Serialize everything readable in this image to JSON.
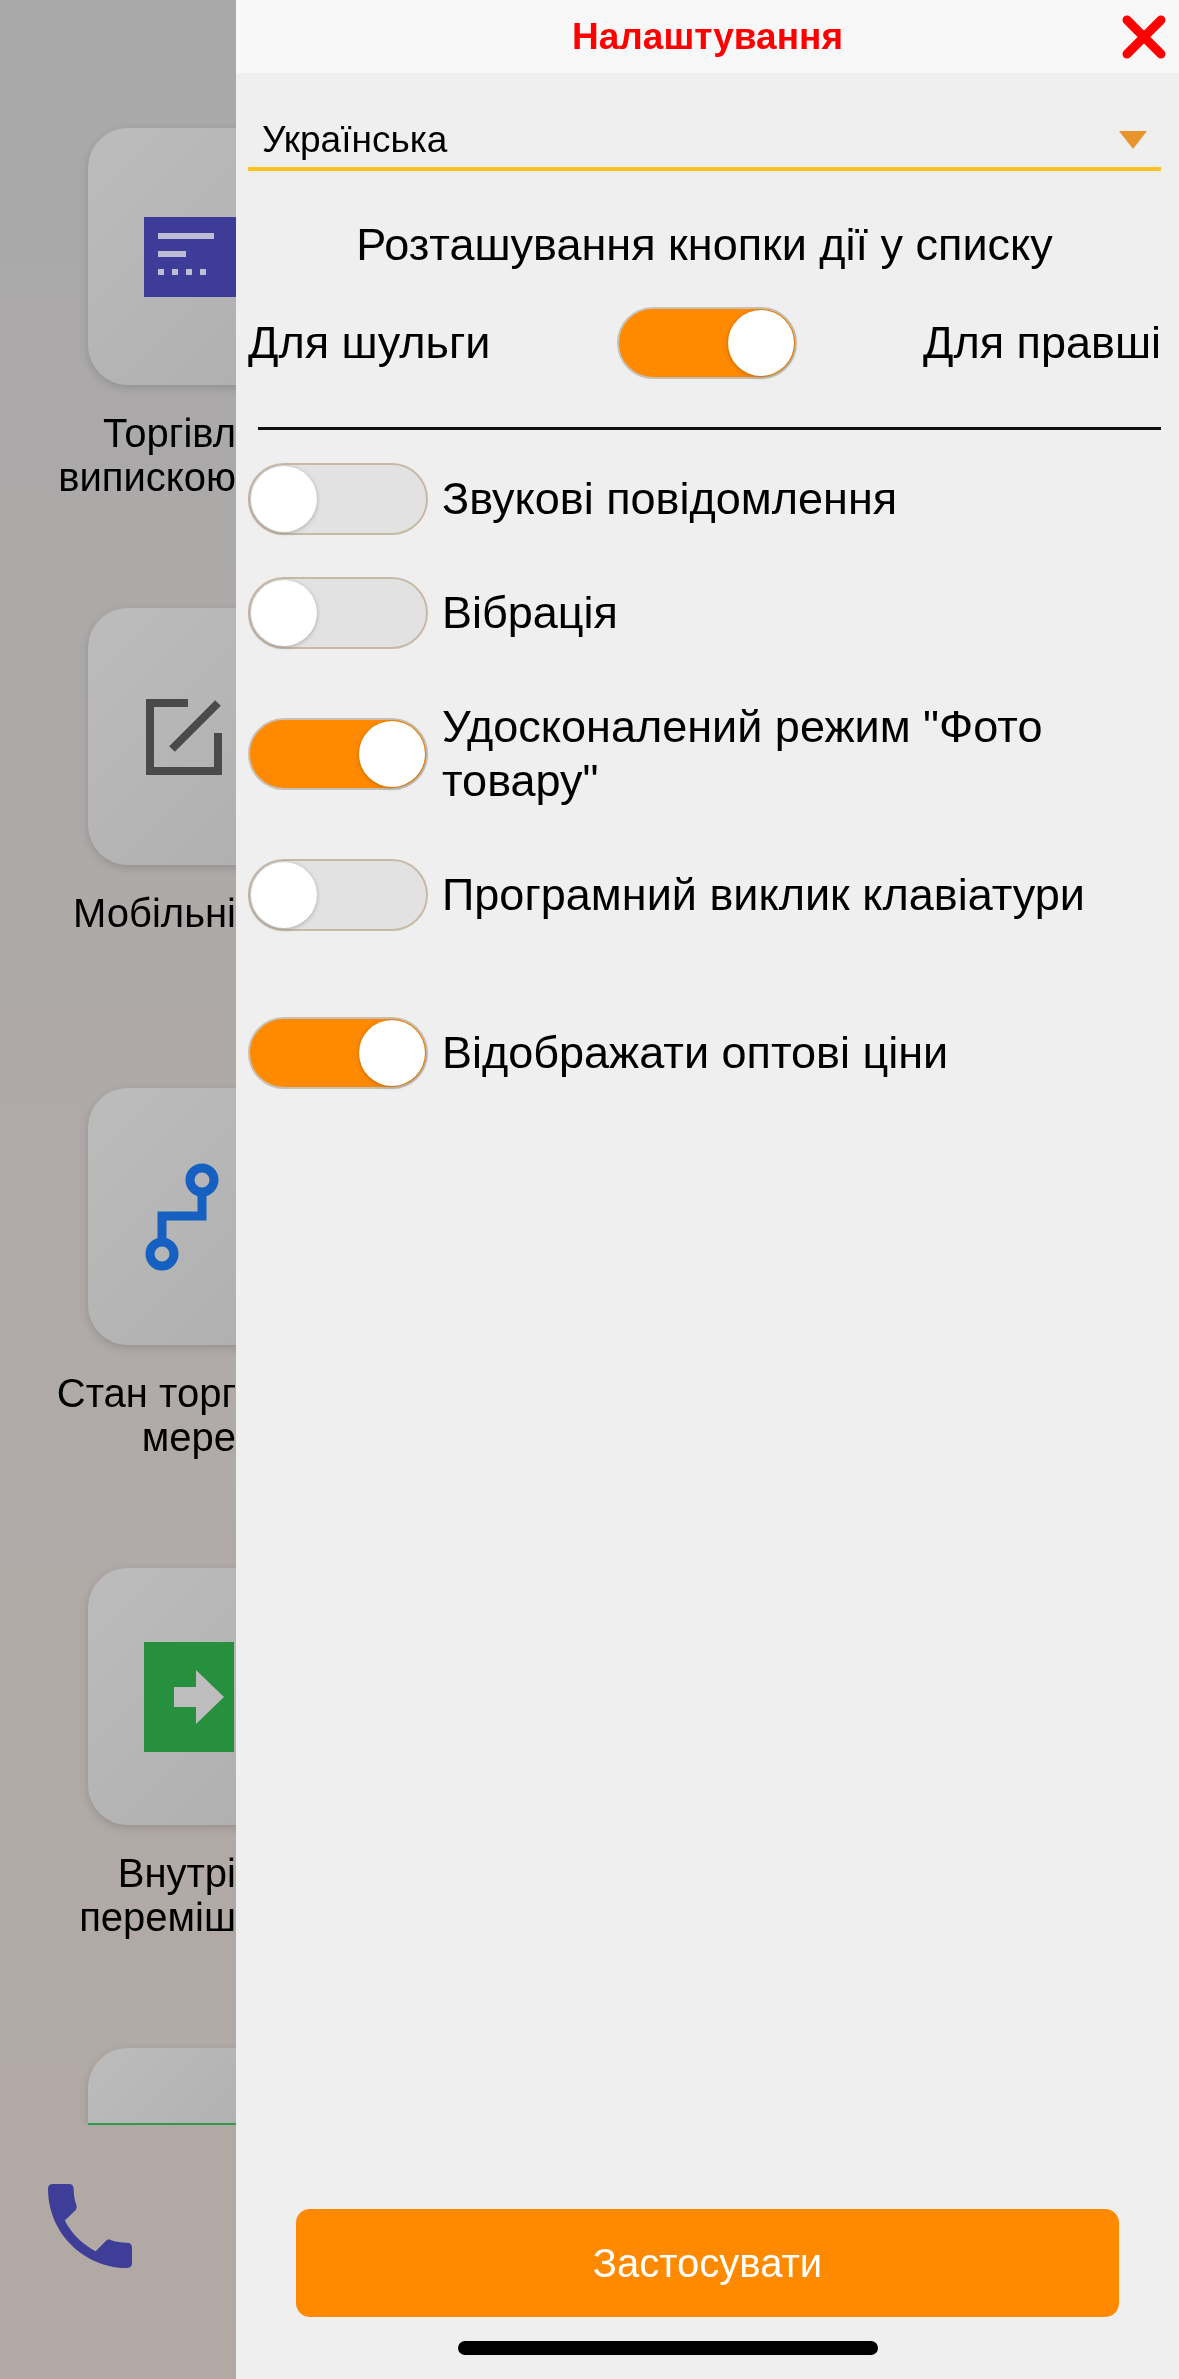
{
  "background": {
    "tiles": [
      {
        "kind": "card",
        "lines": [
          "Торгівл",
          "випискою"
        ]
      },
      {
        "kind": "edit",
        "lines": [
          "Мобільні"
        ]
      },
      {
        "kind": "network",
        "lines": [
          "Стан торг",
          "мере"
        ]
      },
      {
        "kind": "exit",
        "lines": [
          "Внутрі",
          "переміш"
        ]
      },
      {
        "kind": "partial"
      }
    ]
  },
  "header": {
    "title": "Налаштування"
  },
  "language": {
    "value": "Українська"
  },
  "handedness": {
    "heading": "Розташування кнопки дії у списку",
    "left_label": "Для шульги",
    "right_label": "Для правші",
    "on": true
  },
  "options": [
    {
      "label": "Звукові повідомлення",
      "on": false
    },
    {
      "label": "Вібрація",
      "on": false
    },
    {
      "label": "Удосконалений режим \"Фото товару\"",
      "on": true
    },
    {
      "label": "Програмний виклик клавіатури",
      "on": false
    },
    {
      "label": "Відображати оптові ціни",
      "on": true
    }
  ],
  "apply_button": "Застосувати"
}
